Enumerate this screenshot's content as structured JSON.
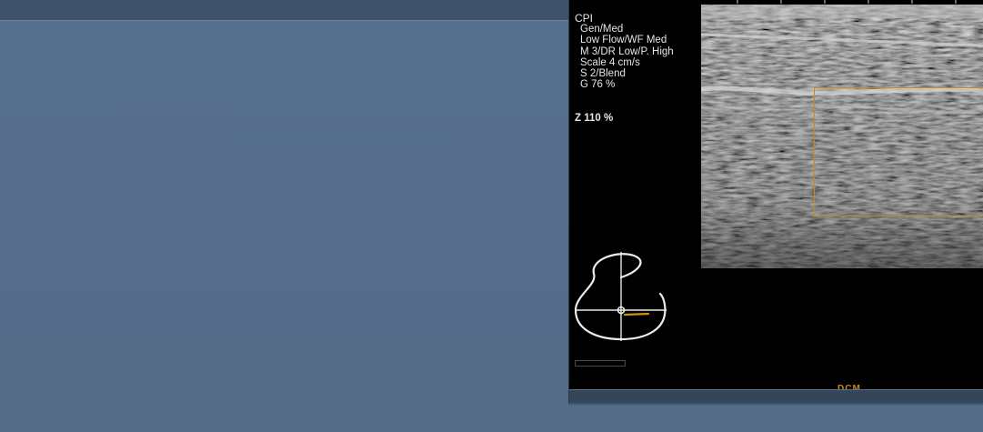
{
  "ultrasound": {
    "mode": "CPI",
    "settings": [
      "Gen/Med",
      "Low Flow/WF Med",
      "M 3/DR Low/P. High",
      "Scale 4 cm/s",
      "S 2/Blend",
      "G 76 %"
    ],
    "zoom": "Z  110  %",
    "bottom_label": "DCM"
  },
  "colors": {
    "background": "#566e8a",
    "viewer": "#000000",
    "roi": "#c88a1a",
    "probe_indicator": "#d4900f"
  },
  "icons": {
    "probe": "breast-probe-position-icon"
  }
}
